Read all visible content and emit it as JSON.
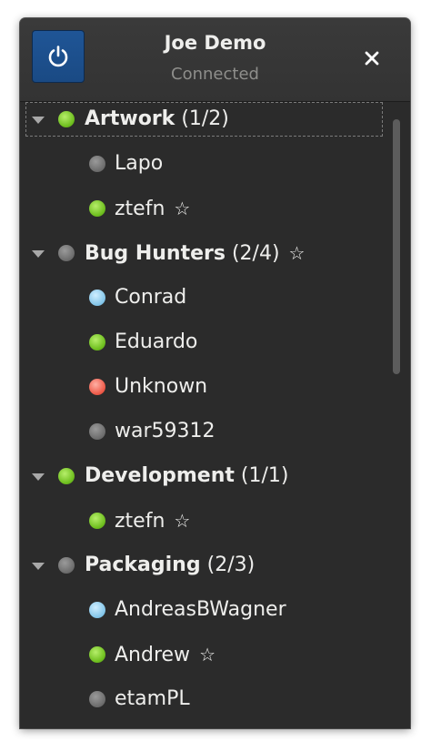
{
  "header": {
    "title": "Joe Demo",
    "subtitle": "Connected",
    "power_icon": "power-icon",
    "close_icon": "close-icon",
    "accent_color": "#1f5596"
  },
  "groups": [
    {
      "name": "Artwork",
      "count": "(1/2)",
      "status": "available",
      "starred": false,
      "contacts": [
        {
          "name": "Lapo",
          "status": "offline",
          "starred": false
        },
        {
          "name": "ztefn",
          "status": "available",
          "starred": true
        }
      ]
    },
    {
      "name": "Bug Hunters",
      "count": "(2/4)",
      "status": "offline",
      "starred": true,
      "contacts": [
        {
          "name": "Conrad",
          "status": "away",
          "starred": false
        },
        {
          "name": "Eduardo",
          "status": "available",
          "starred": false
        },
        {
          "name": "Unknown",
          "status": "busy",
          "starred": false
        },
        {
          "name": "war59312",
          "status": "offline",
          "starred": false
        }
      ]
    },
    {
      "name": "Development",
      "count": "(1/1)",
      "status": "available",
      "starred": false,
      "contacts": [
        {
          "name": "ztefn",
          "status": "available",
          "starred": true
        }
      ]
    },
    {
      "name": "Packaging",
      "count": "(2/3)",
      "status": "offline",
      "starred": false,
      "contacts": [
        {
          "name": "AndreasBWagner",
          "status": "away",
          "starred": false
        },
        {
          "name": "Andrew",
          "status": "available",
          "starred": true
        },
        {
          "name": "etamPL",
          "status": "offline",
          "starred": false
        }
      ]
    }
  ],
  "star_glyph": "☆",
  "status_colors": {
    "available": "#7cc92a",
    "offline": "#7a7a7a",
    "away": "#8ecbec",
    "busy": "#ee5c4b"
  }
}
